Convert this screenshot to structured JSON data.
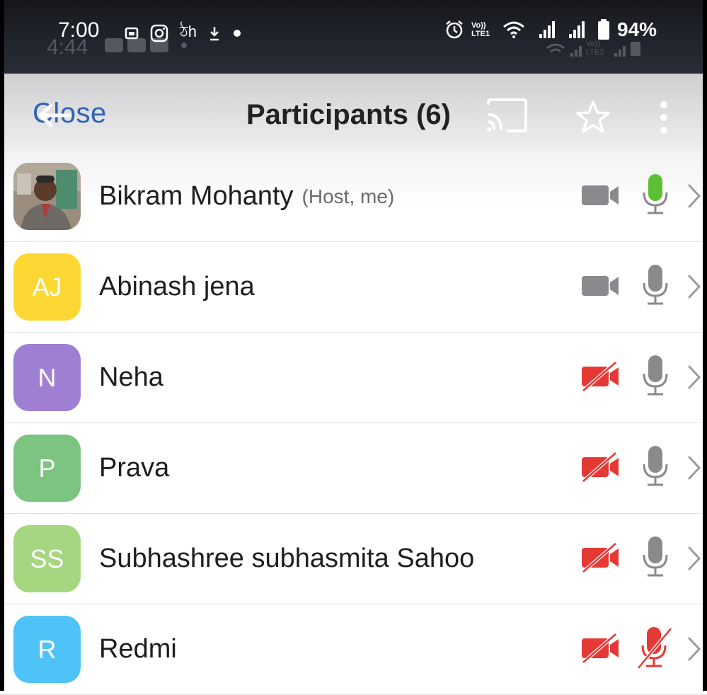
{
  "status_bar": {
    "time": "7:00",
    "ghost_time": "4:44",
    "notif_text": "ঠh",
    "volte_1": "Vo)) LTE1",
    "volte_2": "Vo)) LTE2",
    "battery_pct": "94%"
  },
  "header": {
    "close_label": "Close",
    "title": "Participants (6)"
  },
  "participants": [
    {
      "name": "Bikram Mohanty",
      "tag": "(Host, me)",
      "initials": "",
      "avatar_color": "#8a7a6a",
      "video": "on",
      "mic": "active"
    },
    {
      "name": "Abinash jena",
      "tag": "",
      "initials": "AJ",
      "avatar_color": "#fdd835",
      "video": "on",
      "mic": "on"
    },
    {
      "name": "Neha",
      "tag": "",
      "initials": "N",
      "avatar_color": "#9e7fd3",
      "video": "off",
      "mic": "on"
    },
    {
      "name": "Prava",
      "tag": "",
      "initials": "P",
      "avatar_color": "#7cc47f",
      "video": "off",
      "mic": "on"
    },
    {
      "name": "Subhashree subhasmita Sahoo",
      "tag": "",
      "initials": "SS",
      "avatar_color": "#a6d67f",
      "video": "off",
      "mic": "on"
    },
    {
      "name": "Redmi",
      "tag": "",
      "initials": "R",
      "avatar_color": "#4fc3f7",
      "video": "off",
      "mic": "muted"
    }
  ],
  "colors": {
    "accent": "#2f63b4",
    "mic_active": "#5cc036",
    "muted_red": "#e53935",
    "icon_gray": "#8a8a8e"
  }
}
